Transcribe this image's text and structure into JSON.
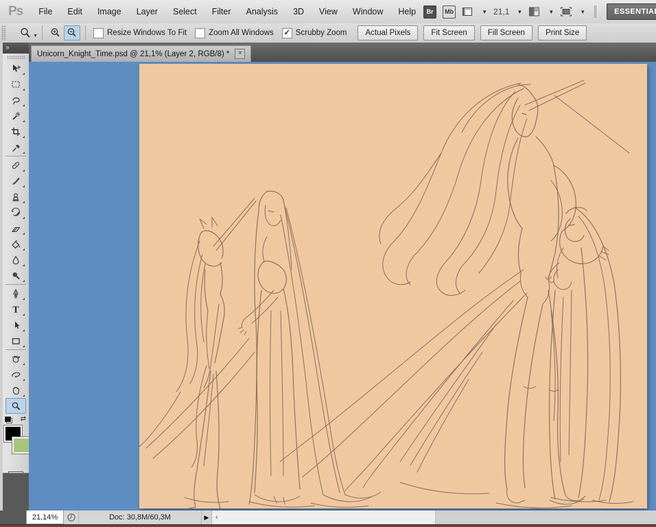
{
  "app": {
    "logo": "Ps",
    "workspace": "ESSENTIALS"
  },
  "menubar": {
    "items": [
      {
        "label": "File"
      },
      {
        "label": "Edit"
      },
      {
        "label": "Image"
      },
      {
        "label": "Layer"
      },
      {
        "label": "Select"
      },
      {
        "label": "Filter"
      },
      {
        "label": "Analysis"
      },
      {
        "label": "3D"
      },
      {
        "label": "View"
      },
      {
        "label": "Window"
      },
      {
        "label": "Help"
      }
    ]
  },
  "topbar": {
    "bridge": "Br",
    "minibridge": "Mb",
    "zoom_level": "21,1"
  },
  "optionsbar": {
    "checkboxes": [
      {
        "label": "Resize Windows To Fit",
        "mark": ""
      },
      {
        "label": "Zoom All Windows",
        "mark": ""
      },
      {
        "label": "Scrubby Zoom",
        "mark": "✓"
      }
    ],
    "buttons": [
      {
        "label": "Actual Pixels"
      },
      {
        "label": "Fit Screen"
      },
      {
        "label": "Fill Screen"
      },
      {
        "label": "Print Size"
      }
    ]
  },
  "document": {
    "tab_title": "Unicorn_Knight_Time.psd @ 21,1% (Layer 2, RGB/8) *",
    "close_glyph": "×"
  },
  "tools": {
    "selected": "zoom-tool",
    "names": [
      "move-tool",
      "marquee-tool",
      "lasso-tool",
      "magic-wand-tool",
      "crop-tool",
      "eyedropper-tool",
      "healing-brush-tool",
      "brush-tool",
      "clone-stamp-tool",
      "history-brush-tool",
      "eraser-tool",
      "paint-bucket-tool",
      "blur-tool",
      "dodge-tool",
      "pen-tool",
      "type-tool",
      "path-selection-tool",
      "rectangle-tool",
      "rotate-3d-tool",
      "orbit-3d-tool",
      "hand-tool",
      "zoom-tool"
    ]
  },
  "colors": {
    "foreground_swatch": "#000000",
    "background_swatch": "#a6c47e",
    "pasteboard": "#5e8dc2",
    "canvas_paper": "#f0c8a0",
    "selection_highlight": "#b9d3ea",
    "bottom_strip": "#7b3e3e"
  },
  "statusbar": {
    "zoom": "21,14%",
    "doc_info": "Doc: 30,8M/60,3M",
    "flyout_glyph": "▶",
    "scroll_left_glyph": "‹"
  },
  "canvas": {
    "description": "Pencil sketch on peach background: small unicorn-headed figure and veiled woman facing each other at left; tall muscular unicorn knight with long flowing mane and horn at right, reaching down to a small veiled woman; long sweeping veil lines cross the scene."
  }
}
